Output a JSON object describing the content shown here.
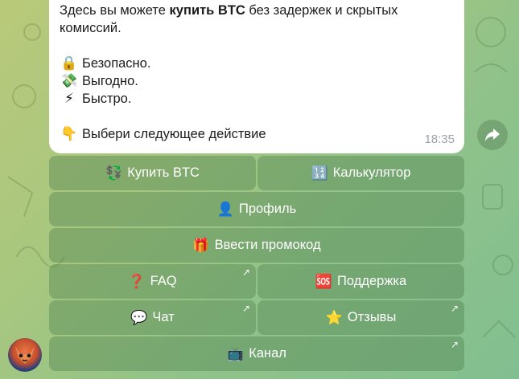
{
  "message": {
    "intro_prefix": "Здесь вы можете ",
    "intro_bold": "купить BTC",
    "intro_suffix": " без задержек и скрытых комиссий.",
    "features": [
      {
        "icon": "lock-icon",
        "glyph": "🔒",
        "text": "Безопасно."
      },
      {
        "icon": "money-icon",
        "glyph": "💸",
        "text": "Выгодно."
      },
      {
        "icon": "lightning-icon",
        "glyph": "⚡",
        "text": "Быстро."
      }
    ],
    "cta_glyph": "👇",
    "cta_text": "Выбери следующее действие",
    "time": "18:35"
  },
  "keyboard": {
    "buy_btc": {
      "glyph": "💱",
      "label": "Купить BTC"
    },
    "calculator": {
      "glyph": "🔢",
      "label": "Калькулятор"
    },
    "profile": {
      "glyph": "👤",
      "label": "Профиль"
    },
    "promo": {
      "glyph": "🎁",
      "label": "Ввести промокод"
    },
    "faq": {
      "glyph": "❓",
      "label": "FAQ"
    },
    "support": {
      "glyph": "🆘",
      "label": "Поддержка"
    },
    "chat": {
      "glyph": "💬",
      "label": "Чат"
    },
    "reviews": {
      "glyph": "⭐",
      "label": "Отзывы"
    },
    "channel": {
      "glyph": "📺",
      "label": "Канал"
    },
    "link_arrow": "↗"
  },
  "colors": {
    "bubble": "#ffffff",
    "button_bg": "rgba(80,130,80,0.42)",
    "time": "#9aa2ab"
  }
}
